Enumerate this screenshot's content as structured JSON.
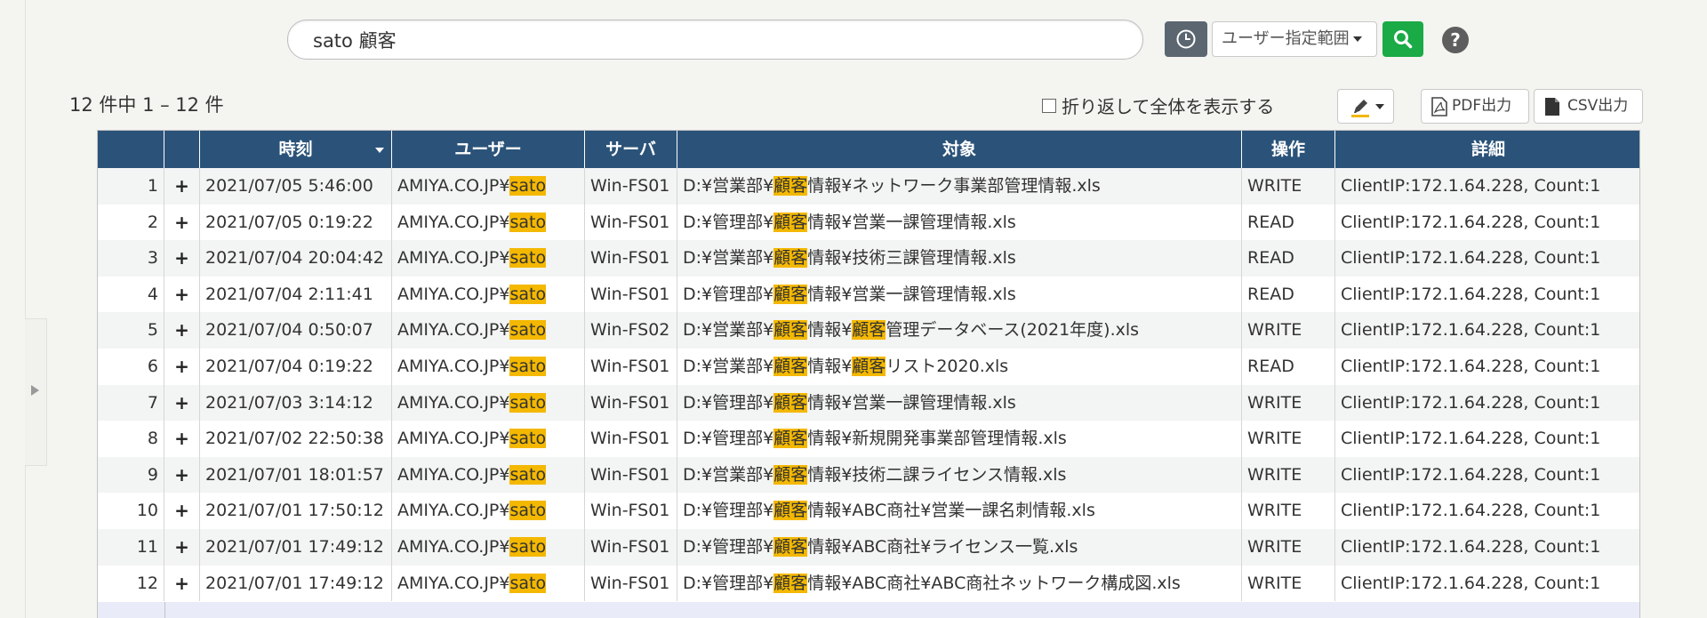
{
  "search": {
    "query": "sato 顧客"
  },
  "toolbar": {
    "range_label": "ユーザー指定範囲",
    "help_label": "?"
  },
  "results": {
    "summary": "12 件中 1 – 12 件",
    "wrap_label": "折り返して全体を表示する",
    "pdf_label": "PDF出力",
    "csv_label": "CSV出力"
  },
  "colors": {
    "header": "#2b5379",
    "highlight": "#f4b800",
    "search_button": "#1aaa46"
  },
  "icons": [
    "clock-icon",
    "search-icon",
    "help-icon",
    "highlighter-icon",
    "pdf-icon",
    "csv-icon",
    "expand-arrow-icon"
  ],
  "table": {
    "columns": [
      "",
      "",
      "時刻",
      "ユーザー",
      "サーバ",
      "対象",
      "操作",
      "詳細"
    ],
    "rows": [
      {
        "no": "1",
        "time": "2021/07/05 5:46:00",
        "user_pre": "AMIYA.CO.JP¥",
        "user_hl": "sato",
        "server": "Win-FS01",
        "t": [
          [
            "D:¥営業部¥",
            false
          ],
          [
            "顧客",
            true
          ],
          [
            "情報¥ネットワーク事業部管理情報.xls",
            false
          ]
        ],
        "op": "WRITE",
        "detail": "ClientIP:172.1.64.228, Count:1"
      },
      {
        "no": "2",
        "time": "2021/07/05 0:19:22",
        "user_pre": "AMIYA.CO.JP¥",
        "user_hl": "sato",
        "server": "Win-FS01",
        "t": [
          [
            "D:¥管理部¥",
            false
          ],
          [
            "顧客",
            true
          ],
          [
            "情報¥営業一課管理情報.xls",
            false
          ]
        ],
        "op": "READ",
        "detail": "ClientIP:172.1.64.228, Count:1"
      },
      {
        "no": "3",
        "time": "2021/07/04 20:04:42",
        "user_pre": "AMIYA.CO.JP¥",
        "user_hl": "sato",
        "server": "Win-FS01",
        "t": [
          [
            "D:¥営業部¥",
            false
          ],
          [
            "顧客",
            true
          ],
          [
            "情報¥技術三課管理情報.xls",
            false
          ]
        ],
        "op": "READ",
        "detail": "ClientIP:172.1.64.228, Count:1"
      },
      {
        "no": "4",
        "time": "2021/07/04 2:11:41",
        "user_pre": "AMIYA.CO.JP¥",
        "user_hl": "sato",
        "server": "Win-FS01",
        "t": [
          [
            "D:¥管理部¥",
            false
          ],
          [
            "顧客",
            true
          ],
          [
            "情報¥営業一課管理情報.xls",
            false
          ]
        ],
        "op": "READ",
        "detail": "ClientIP:172.1.64.228, Count:1"
      },
      {
        "no": "5",
        "time": "2021/07/04 0:50:07",
        "user_pre": "AMIYA.CO.JP¥",
        "user_hl": "sato",
        "server": "Win-FS02",
        "t": [
          [
            "D:¥営業部¥",
            false
          ],
          [
            "顧客",
            true
          ],
          [
            "情報¥",
            false
          ],
          [
            "顧客",
            true
          ],
          [
            "管理データベース(2021年度).xls",
            false
          ]
        ],
        "op": "WRITE",
        "detail": "ClientIP:172.1.64.228, Count:1"
      },
      {
        "no": "6",
        "time": "2021/07/04 0:19:22",
        "user_pre": "AMIYA.CO.JP¥",
        "user_hl": "sato",
        "server": "Win-FS01",
        "t": [
          [
            "D:¥営業部¥",
            false
          ],
          [
            "顧客",
            true
          ],
          [
            "情報¥",
            false
          ],
          [
            "顧客",
            true
          ],
          [
            "リスト2020.xls",
            false
          ]
        ],
        "op": "READ",
        "detail": "ClientIP:172.1.64.228, Count:1"
      },
      {
        "no": "7",
        "time": "2021/07/03 3:14:12",
        "user_pre": "AMIYA.CO.JP¥",
        "user_hl": "sato",
        "server": "Win-FS01",
        "t": [
          [
            "D:¥管理部¥",
            false
          ],
          [
            "顧客",
            true
          ],
          [
            "情報¥営業一課管理情報.xls",
            false
          ]
        ],
        "op": "WRITE",
        "detail": "ClientIP:172.1.64.228, Count:1"
      },
      {
        "no": "8",
        "time": "2021/07/02 22:50:38",
        "user_pre": "AMIYA.CO.JP¥",
        "user_hl": "sato",
        "server": "Win-FS01",
        "t": [
          [
            "D:¥管理部¥",
            false
          ],
          [
            "顧客",
            true
          ],
          [
            "情報¥新規開発事業部管理情報.xls",
            false
          ]
        ],
        "op": "WRITE",
        "detail": "ClientIP:172.1.64.228, Count:1"
      },
      {
        "no": "9",
        "time": "2021/07/01 18:01:57",
        "user_pre": "AMIYA.CO.JP¥",
        "user_hl": "sato",
        "server": "Win-FS01",
        "t": [
          [
            "D:¥営業部¥",
            false
          ],
          [
            "顧客",
            true
          ],
          [
            "情報¥技術二課ライセンス情報.xls",
            false
          ]
        ],
        "op": "WRITE",
        "detail": "ClientIP:172.1.64.228, Count:1"
      },
      {
        "no": "10",
        "time": "2021/07/01 17:50:12",
        "user_pre": "AMIYA.CO.JP¥",
        "user_hl": "sato",
        "server": "Win-FS01",
        "t": [
          [
            "D:¥管理部¥",
            false
          ],
          [
            "顧客",
            true
          ],
          [
            "情報¥ABC商社¥営業一課名刺情報.xls",
            false
          ]
        ],
        "op": "WRITE",
        "detail": "ClientIP:172.1.64.228, Count:1"
      },
      {
        "no": "11",
        "time": "2021/07/01 17:49:12",
        "user_pre": "AMIYA.CO.JP¥",
        "user_hl": "sato",
        "server": "Win-FS01",
        "t": [
          [
            "D:¥管理部¥",
            false
          ],
          [
            "顧客",
            true
          ],
          [
            "情報¥ABC商社¥ライセンス一覧.xls",
            false
          ]
        ],
        "op": "WRITE",
        "detail": "ClientIP:172.1.64.228, Count:1"
      },
      {
        "no": "12",
        "time": "2021/07/01 17:49:12",
        "user_pre": "AMIYA.CO.JP¥",
        "user_hl": "sato",
        "server": "Win-FS01",
        "t": [
          [
            "D:¥管理部¥",
            false
          ],
          [
            "顧客",
            true
          ],
          [
            "情報¥ABC商社¥ABC商社ネットワーク構成図.xls",
            false
          ]
        ],
        "op": "WRITE",
        "detail": "ClientIP:172.1.64.228, Count:1"
      }
    ]
  }
}
